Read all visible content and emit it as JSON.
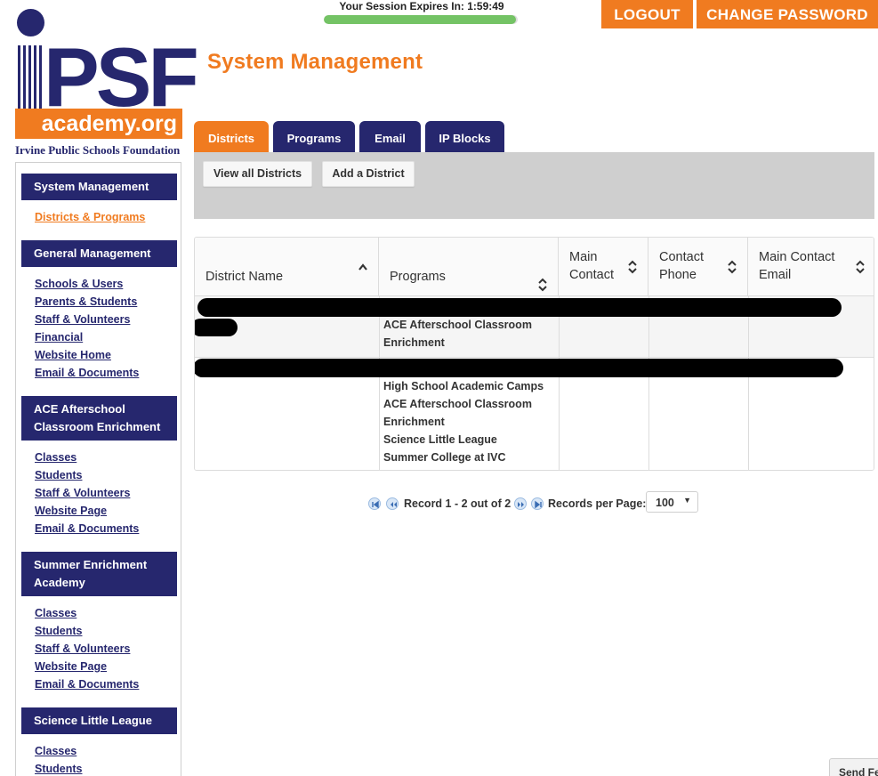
{
  "session": {
    "label": "Your Session Expires In: 1:59:49",
    "progress_percent": 99
  },
  "header": {
    "logout_label": "LOGOUT",
    "change_password_label": "CHANGE PASSWORD"
  },
  "logo": {
    "letters": "PSF",
    "academy": "academy.org",
    "foundation": "Irvine Public Schools Foundation"
  },
  "sidebar": {
    "sections": [
      {
        "title": "System Management",
        "links": [
          "Districts & Programs"
        ],
        "active_link": 0
      },
      {
        "title": "General Management",
        "links": [
          "Schools & Users",
          "Parents & Students",
          "Staff & Volunteers",
          "Financial",
          "Website Home",
          "Email & Documents"
        ]
      },
      {
        "title_lines": [
          "ACE Afterschool",
          "Classroom Enrichment"
        ],
        "links": [
          "Classes",
          "Students",
          "Staff & Volunteers",
          "Website Page",
          "Email & Documents"
        ]
      },
      {
        "title_lines": [
          "Summer Enrichment",
          "Academy"
        ],
        "links": [
          "Classes",
          "Students",
          "Staff & Volunteers",
          "Website Page",
          "Email & Documents"
        ]
      },
      {
        "title": "Science Little League",
        "links": [
          "Classes",
          "Students"
        ]
      }
    ]
  },
  "page": {
    "title": "System Management"
  },
  "tabs": [
    {
      "label": "Districts",
      "active": true
    },
    {
      "label": "Programs"
    },
    {
      "label": "Email"
    },
    {
      "label": "IP Blocks"
    }
  ],
  "toolbar": {
    "view_all_label": "View all Districts",
    "add_label": "Add a District"
  },
  "table": {
    "columns": [
      {
        "label": "District Name",
        "sort": "asc"
      },
      {
        "label": "Programs",
        "sort": "none"
      },
      {
        "label_lines": [
          "Main",
          "Contact"
        ],
        "sort": "none"
      },
      {
        "label_lines": [
          "Contact",
          "Phone"
        ],
        "sort": "none"
      },
      {
        "label_lines": [
          "Main Contact",
          "Email"
        ],
        "sort": "none"
      }
    ],
    "rows": [
      {
        "programs_visible": [
          "ACE Afterschool Classroom",
          "Enrichment"
        ]
      },
      {
        "programs_visible": [
          "High School Academic Camps",
          "ACE Afterschool Classroom",
          "Enrichment",
          "Science Little League",
          "Summer College at IVC"
        ]
      }
    ]
  },
  "pager": {
    "record_text": "Record 1 - 2 out of 2",
    "per_page_label": "Records per Page:",
    "per_page_value": "100"
  },
  "feedback": {
    "label": "Send Fe"
  },
  "colors": {
    "brand_navy": "#26276e",
    "brand_orange": "#f07b20",
    "session_bar": "#74c365"
  }
}
